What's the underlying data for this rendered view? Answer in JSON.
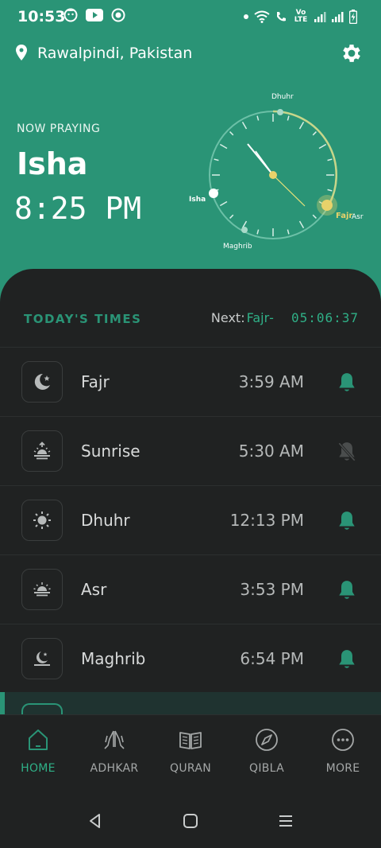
{
  "status": {
    "time": "10:53",
    "volte": "Vo LTE"
  },
  "header": {
    "location": "Rawalpindi, Pakistan"
  },
  "now": {
    "label": "NOW PRAYING",
    "name": "Isha",
    "time": "8:25 PM"
  },
  "clock": {
    "dhuhr": "Dhuhr",
    "isha": "Isha",
    "maghrib": "Maghrib",
    "fajr": "Fajr",
    "asr": "Asr"
  },
  "today": {
    "label": "TODAY'S TIMES",
    "next_prefix": "Next:",
    "next_name": "Fajr",
    "next_dash": "-",
    "countdown": "05:06:37"
  },
  "prayers": [
    {
      "name": "Fajr",
      "time": "3:59 AM",
      "icon": "crescent-star-icon",
      "alarm_on": true
    },
    {
      "name": "Sunrise",
      "time": "5:30 AM",
      "icon": "sunrise-icon",
      "alarm_on": false
    },
    {
      "name": "Dhuhr",
      "time": "12:13 PM",
      "icon": "sun-icon",
      "alarm_on": true
    },
    {
      "name": "Asr",
      "time": "3:53 PM",
      "icon": "sunset-icon",
      "alarm_on": true
    },
    {
      "name": "Maghrib",
      "time": "6:54 PM",
      "icon": "moon-icon",
      "alarm_on": true
    }
  ],
  "nav": [
    {
      "label": "HOME",
      "icon": "home-icon",
      "active": true
    },
    {
      "label": "ADHKAR",
      "icon": "praying-hands-icon",
      "active": false
    },
    {
      "label": "QURAN",
      "icon": "book-icon",
      "active": false
    },
    {
      "label": "QIBLA",
      "icon": "compass-icon",
      "active": false
    },
    {
      "label": "MORE",
      "icon": "more-icon",
      "active": false
    }
  ],
  "colors": {
    "accent": "#2a9476",
    "accent_bright": "#2fb087",
    "panel": "#202222",
    "bell_off": "#4a4d4d"
  }
}
